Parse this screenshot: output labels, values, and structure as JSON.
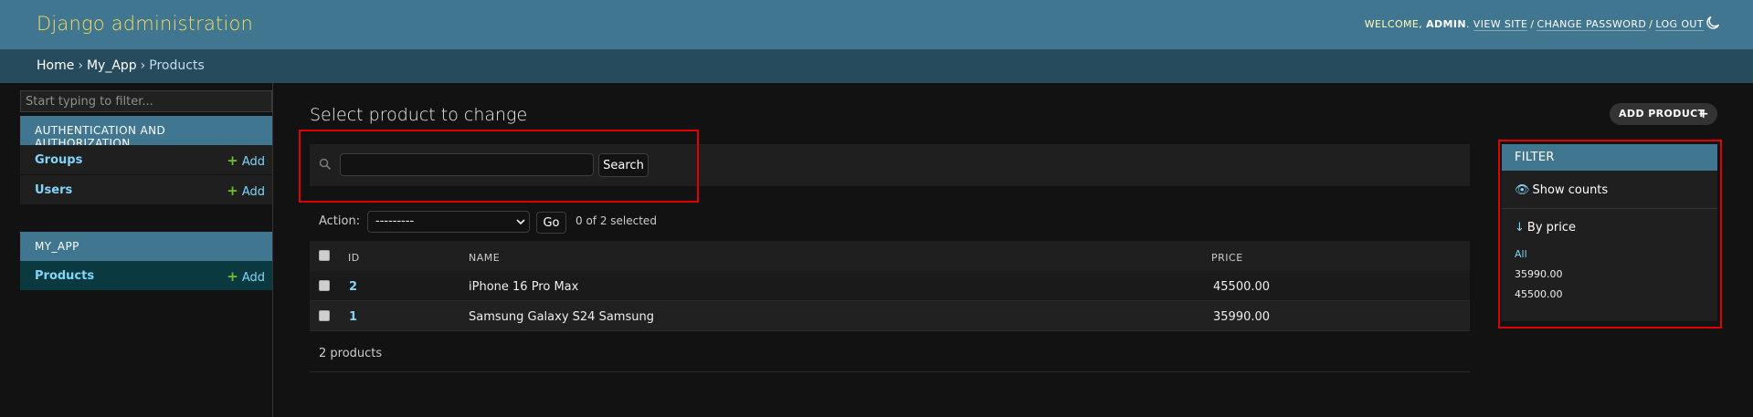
{
  "header": {
    "branding": "Django administration",
    "welcome": "WELCOME,",
    "username": "ADMIN",
    "view_site": "VIEW SITE",
    "change_password": "CHANGE PASSWORD",
    "log_out": "LOG OUT",
    "theme_icon": "moon-icon"
  },
  "breadcrumbs": {
    "home": "Home",
    "app": "My_App",
    "current": "Products"
  },
  "sidebar": {
    "filter_placeholder": "Start typing to filter...",
    "apps": [
      {
        "caption": "AUTHENTICATION AND AUTHORIZATION",
        "models": [
          {
            "name": "Groups",
            "add": "Add"
          },
          {
            "name": "Users",
            "add": "Add"
          }
        ]
      },
      {
        "caption": "MY_APP",
        "models": [
          {
            "name": "Products",
            "add": "Add"
          }
        ]
      }
    ]
  },
  "main": {
    "title": "Select product to change",
    "add_button": "ADD PRODUCT",
    "search_button": "Search",
    "search_value": "",
    "action_label": "Action:",
    "action_selected": "---------",
    "go_button": "Go",
    "selected_count": "0 of 2 selected",
    "columns": {
      "id": "ID",
      "name": "NAME",
      "price": "PRICE"
    },
    "rows": [
      {
        "id": "2",
        "name": "iPhone 16 Pro Max",
        "price": "45500.00"
      },
      {
        "id": "1",
        "name": "Samsung Galaxy S24 Samsung",
        "price": "35990.00"
      }
    ],
    "paginator": "2 products"
  },
  "filter": {
    "title": "FILTER",
    "show_counts": "Show counts",
    "by_price": "By price",
    "choices": [
      "All",
      "35990.00",
      "45500.00"
    ]
  },
  "colors": {
    "header": "#417690",
    "breadcrumbs": "#264b5d",
    "branding": "#f5dd5d",
    "link": "#81d4fa",
    "add_plus": "#70bf2b",
    "highlight": "#e00000"
  }
}
